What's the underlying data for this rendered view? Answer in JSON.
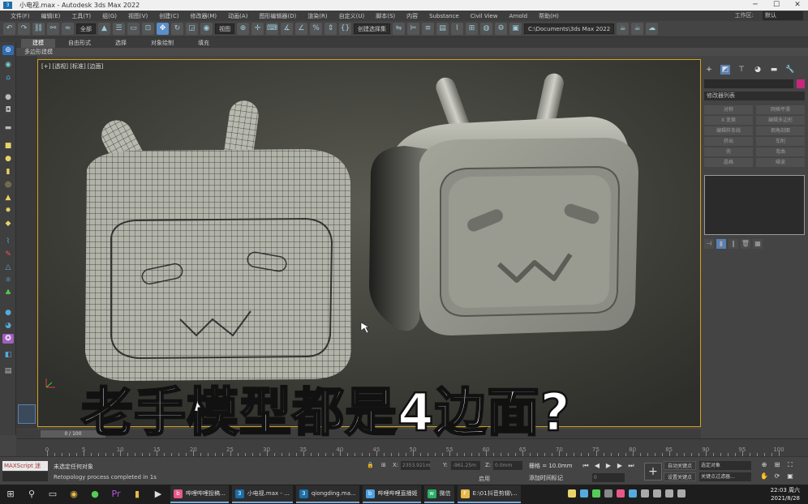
{
  "window": {
    "title": "小电视.max - Autodesk 3ds Max 2022",
    "icon_text": "3"
  },
  "menu": {
    "items": [
      "文件(F)",
      "编辑(E)",
      "工具(T)",
      "组(G)",
      "视图(V)",
      "创建(C)",
      "修改器(M)",
      "动画(A)",
      "图形编辑器(D)",
      "渲染(R)",
      "自定义(U)",
      "脚本(S)",
      "内容",
      "Substance",
      "Civil View",
      "Arnold",
      "帮助(H)"
    ],
    "workspace_label": "工作区:",
    "workspace_value": "默认"
  },
  "toolbar": {
    "selection_filter": "全部",
    "ref_coord": "视图",
    "named_selection": "创建选择集",
    "project_path": "C:\\Documents\\3ds Max 2022"
  },
  "ribbon": {
    "tabs": [
      "建模",
      "自由形式",
      "选择",
      "对象绘制",
      "填充"
    ],
    "sub": "多边形建模"
  },
  "viewport": {
    "label": "[+] [透视] [标准] [边面]"
  },
  "overlay": {
    "caption": "老手模型都是4边面?"
  },
  "command_panel": {
    "list_label": "修改器列表",
    "modifiers": [
      "对称",
      "网格平滑",
      "X 变换",
      "编辑多边形",
      "编辑样条线",
      "倒角剖面",
      "挤出",
      "车削",
      "壳",
      "弯曲",
      "晶格",
      "噪波"
    ]
  },
  "timeline": {
    "slider": "0 / 100",
    "ticks": [
      "0",
      "5",
      "10",
      "15",
      "20",
      "25",
      "30",
      "35",
      "40",
      "45",
      "50",
      "55",
      "60",
      "65",
      "70",
      "75",
      "80",
      "85",
      "90",
      "95",
      "100"
    ]
  },
  "status": {
    "maxscript": "MAXScript 迷",
    "line1": "未选定任何对象",
    "line2": "Retopology process completed in 1s",
    "x_label": "X:",
    "y_label": "Y:",
    "z_label": "Z:",
    "x_value": "2353.921m",
    "y_value": "-961.25m",
    "z_value": "0.0mm",
    "grid": "栅格 = 10.0mm",
    "enable": "启用",
    "add_time_tag": "添加时间标记",
    "auto_key": "自动关键点",
    "set_key": "设置关键点",
    "selection_sets": "选定对象",
    "key_filters": "关键点过滤器...",
    "frame": "0"
  },
  "taskbar": {
    "apps": [
      {
        "label": "哔哩哔哩投稿...",
        "color": "#e8578a",
        "icon": "b"
      },
      {
        "label": "小电视.max - ...",
        "color": "#1a6fa8",
        "icon": "3"
      },
      {
        "label": "qiongding.ma...",
        "color": "#1a6fa8",
        "icon": "3"
      },
      {
        "label": "哔哩哔哩直播姬",
        "color": "#4aa3e8",
        "icon": "b"
      },
      {
        "label": "微信",
        "color": "#2aae67",
        "icon": "w"
      },
      {
        "label": "E:\\01抖音剪辑\\...",
        "color": "#e8b84a",
        "icon": "F"
      }
    ],
    "time": "22:03 周六",
    "date": "2021/8/28"
  }
}
